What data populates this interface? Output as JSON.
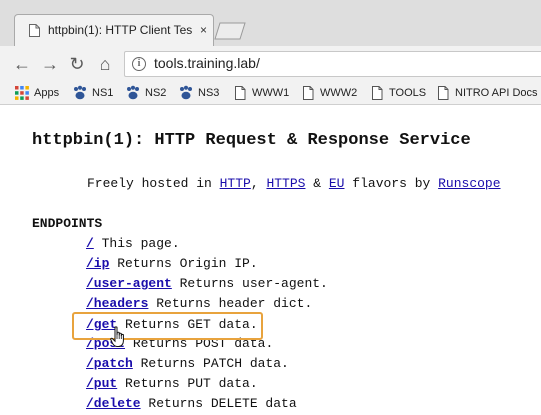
{
  "browser": {
    "tab": {
      "title": "httpbin(1): HTTP Client Tes",
      "close_glyph": "×"
    },
    "nav": {
      "back_glyph": "←",
      "forward_glyph": "→",
      "reload_glyph": "↻",
      "home_glyph": "⌂"
    },
    "omnibox": {
      "url": "tools.training.lab/",
      "info_glyph": "i"
    },
    "bookmarks": [
      {
        "label": "Apps",
        "icon": "apps-grid-icon"
      },
      {
        "label": "NS1",
        "icon": "paw-icon"
      },
      {
        "label": "NS2",
        "icon": "paw-icon"
      },
      {
        "label": "NS3",
        "icon": "paw-icon"
      },
      {
        "label": "WWW1",
        "icon": "page-icon"
      },
      {
        "label": "WWW2",
        "icon": "page-icon"
      },
      {
        "label": "TOOLS",
        "icon": "page-icon"
      },
      {
        "label": "NITRO API Docs",
        "icon": "page-icon"
      }
    ]
  },
  "page": {
    "title": "httpbin(1): HTTP Request & Response Service",
    "intro": {
      "prefix": "Freely hosted in ",
      "http": "HTTP",
      "sep1": ", ",
      "https": "HTTPS",
      "sep2": " & ",
      "eu": "EU",
      "mid": " flavors by ",
      "runscope": "Runscope"
    },
    "section_heading": "ENDPOINTS",
    "endpoints": [
      {
        "path": "/",
        "desc": " This page."
      },
      {
        "path": "/ip",
        "desc": " Returns Origin IP."
      },
      {
        "path": "/user-agent",
        "desc": " Returns user-agent."
      },
      {
        "path": "/headers",
        "desc": " Returns header dict."
      },
      {
        "path": "/get",
        "desc": " Returns GET data."
      },
      {
        "path": "/post",
        "desc": " Returns POST data."
      },
      {
        "path": "/patch",
        "desc": " Returns PATCH data."
      },
      {
        "path": "/put",
        "desc": " Returns PUT data."
      },
      {
        "path": "/delete",
        "desc": " Returns DELETE data"
      }
    ]
  },
  "colors": {
    "link": "#1a0dab",
    "highlight": "#e8a33d"
  }
}
